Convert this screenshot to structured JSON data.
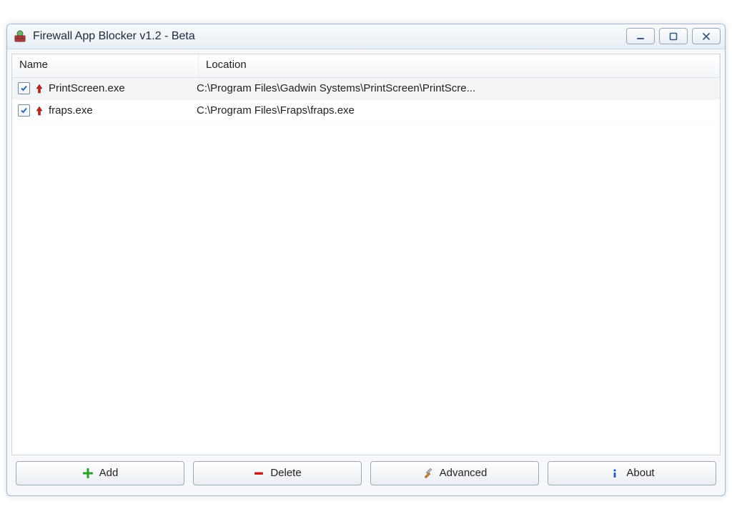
{
  "window": {
    "title": "Firewall App Blocker v1.2 - Beta"
  },
  "list": {
    "columns": {
      "name": "Name",
      "location": "Location"
    },
    "rows": [
      {
        "checked": true,
        "name": "PrintScreen.exe",
        "location": "C:\\Program Files\\Gadwin Systems\\PrintScreen\\PrintScre...",
        "selected": true
      },
      {
        "checked": true,
        "name": "fraps.exe",
        "location": "C:\\Program Files\\Fraps\\fraps.exe",
        "selected": false
      }
    ]
  },
  "toolbar": {
    "add": "Add",
    "delete": "Delete",
    "advanced": "Advanced",
    "about": "About"
  }
}
